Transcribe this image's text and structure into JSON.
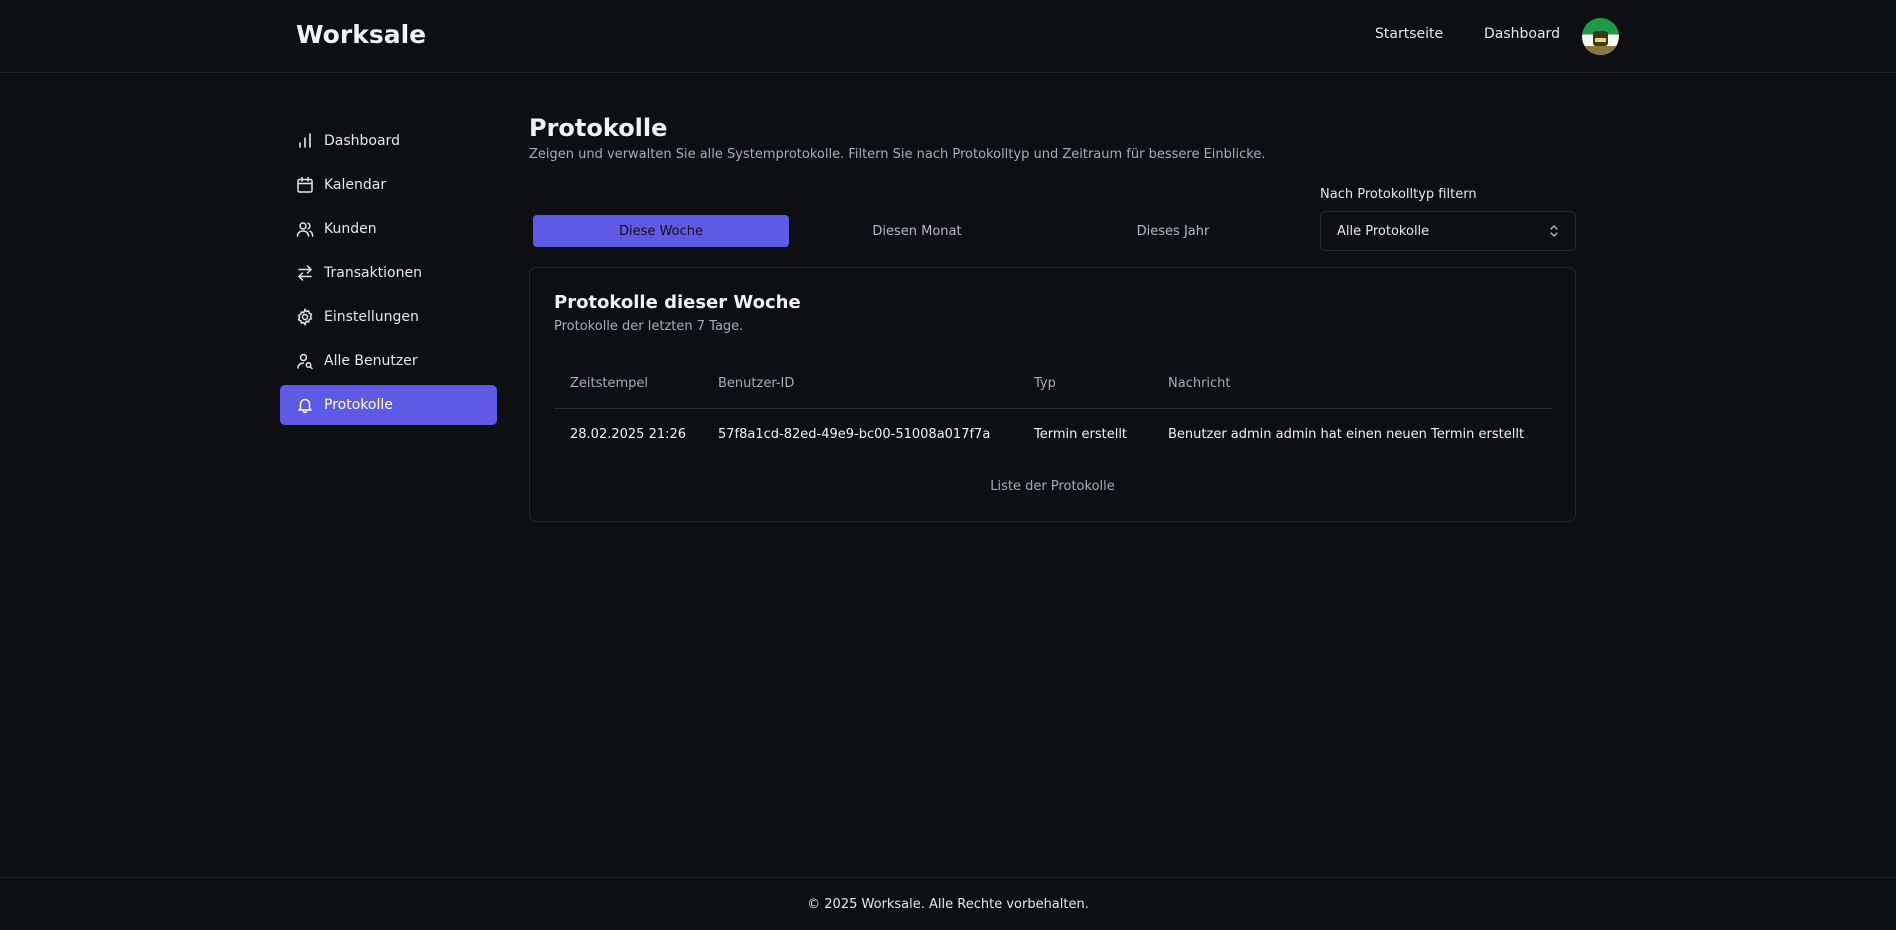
{
  "header": {
    "brand": "Worksale",
    "nav": [
      {
        "label": "Startseite"
      },
      {
        "label": "Dashboard"
      }
    ]
  },
  "sidebar": {
    "items": [
      {
        "label": "Dashboard",
        "icon": "bar-chart-icon"
      },
      {
        "label": "Kalendar",
        "icon": "calendar-icon"
      },
      {
        "label": "Kunden",
        "icon": "users-icon"
      },
      {
        "label": "Transaktionen",
        "icon": "arrows-left-right-icon"
      },
      {
        "label": "Einstellungen",
        "icon": "gear-icon"
      },
      {
        "label": "Alle Benutzer",
        "icon": "user-search-icon"
      },
      {
        "label": "Protokolle",
        "icon": "bell-icon",
        "active": true
      }
    ]
  },
  "main": {
    "title": "Protokolle",
    "subtitle": "Zeigen und verwalten Sie alle Systemprotokolle. Filtern Sie nach Protokolltyp und Zeitraum für bessere Einblicke.",
    "tabs": [
      {
        "label": "Diese Woche",
        "active": true
      },
      {
        "label": "Diesen Monat"
      },
      {
        "label": "Dieses Jahr"
      }
    ],
    "filter": {
      "label": "Nach Protokolltyp filtern",
      "value": "Alle Protokolle"
    },
    "card": {
      "title": "Protokolle dieser Woche",
      "subtitle": "Protokolle der letzten 7 Tage.",
      "columns": [
        "Zeitstempel",
        "Benutzer-ID",
        "Typ",
        "Nachricht"
      ],
      "rows": [
        [
          "28.02.2025 21:26",
          "57f8a1cd-82ed-49e9-bc00-51008a017f7a",
          "Termin erstellt",
          "Benutzer admin admin hat einen neuen Termin erstellt"
        ]
      ],
      "caption": "Liste der Protokolle"
    }
  },
  "footer": {
    "text": "© 2025 Worksale. Alle Rechte vorbehalten."
  },
  "colors": {
    "background": "#0e0f12",
    "accent": "#5f5ae6",
    "border": "#26272c"
  }
}
